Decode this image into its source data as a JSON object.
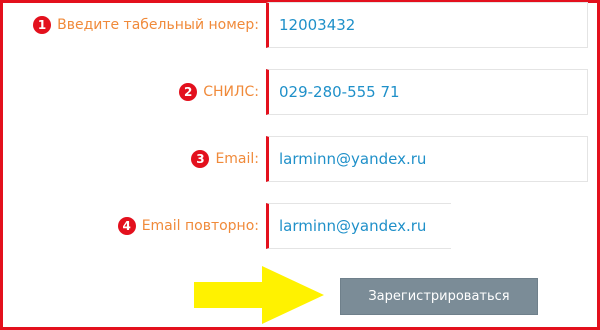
{
  "form": {
    "fields": [
      {
        "number": "1",
        "label": "Введите табельный номер:",
        "value": "12003432"
      },
      {
        "number": "2",
        "label": "СНИЛС:",
        "value": "029-280-555 71"
      },
      {
        "number": "3",
        "label": "Email:",
        "value": "larminn@yandex.ru"
      },
      {
        "number": "4",
        "label": "Email повторно:",
        "value": "larminn@yandex.ru"
      }
    ],
    "submit_label": "Зарегистрироваться"
  },
  "colors": {
    "frame": "#e3101d",
    "badge": "#e3101d",
    "label": "#f08a3a",
    "value": "#1f90c9",
    "button": "#7b8c97",
    "arrow": "#fff200"
  },
  "icons": {
    "pointer": "yellow-arrow-icon"
  }
}
